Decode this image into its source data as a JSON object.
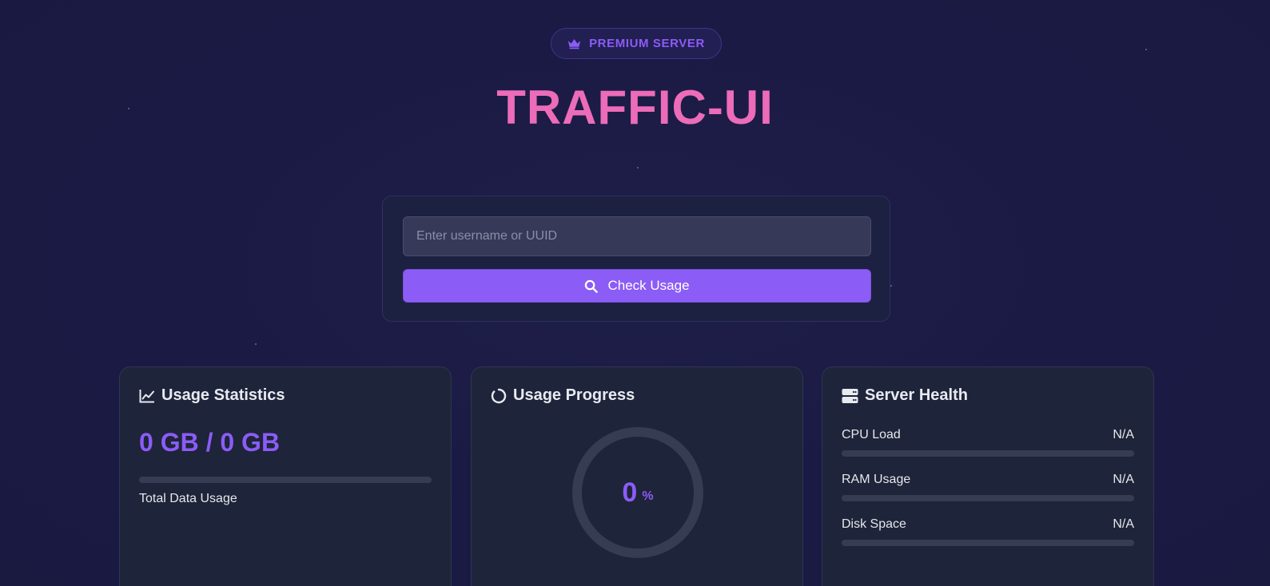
{
  "header": {
    "badge_icon": "crown-icon",
    "badge_label": "PREMIUM SERVER",
    "title": "TRAFFIC-UI"
  },
  "search": {
    "placeholder": "Enter username or UUID",
    "value": "",
    "button_icon": "search-icon",
    "button_label": "Check Usage"
  },
  "usage_statistics": {
    "icon": "line-chart-icon",
    "title": "Usage Statistics",
    "value": "0 GB / 0 GB",
    "progress": 0,
    "caption": "Total Data Usage"
  },
  "usage_progress": {
    "icon": "circle-notch-icon",
    "title": "Usage Progress",
    "percent_value": "0",
    "percent_unit": "%",
    "progress": 0
  },
  "server_health": {
    "icon": "server-icon",
    "title": "Server Health",
    "metrics": [
      {
        "label": "CPU Load",
        "value": "N/A",
        "progress": 0
      },
      {
        "label": "RAM Usage",
        "value": "N/A",
        "progress": 0
      },
      {
        "label": "Disk Space",
        "value": "N/A",
        "progress": 0
      }
    ]
  },
  "colors": {
    "background": "#1b1a44",
    "accent": "#8b5cf6",
    "title": "#ec6cb9",
    "card": "#1e2439",
    "track": "#363c52"
  }
}
